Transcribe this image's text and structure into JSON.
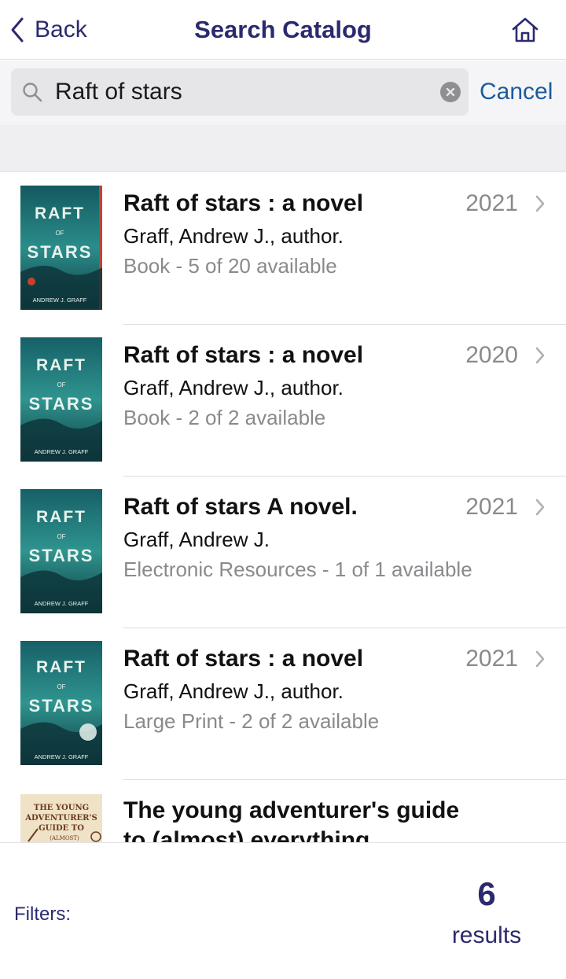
{
  "nav": {
    "back_label": "Back",
    "title": "Search Catalog",
    "home_icon": "home-icon"
  },
  "search": {
    "value": "Raft of stars",
    "placeholder": "",
    "cancel_label": "Cancel"
  },
  "results": [
    {
      "title": "Raft of stars : a novel",
      "author": "Graff, Andrew J., author.",
      "format": "Book - 5 of 20 available",
      "year": "2021",
      "cover": {
        "line1": "RAFT",
        "line2": "OF",
        "line3": "STARS",
        "byline": "ANDREW J. GRAFF"
      }
    },
    {
      "title": "Raft of stars : a novel",
      "author": "Graff, Andrew J., author.",
      "format": "Book - 2 of 2 available",
      "year": "2020",
      "cover": {
        "line1": "RAFT",
        "line2": "OF",
        "line3": "STARS",
        "byline": "ANDREW J. GRAFF"
      }
    },
    {
      "title": "Raft of stars A novel.",
      "author": "Graff, Andrew J.",
      "format": "Electronic Resources - 1 of 1 available",
      "year": "2021",
      "cover": {
        "line1": "RAFT",
        "line2": "OF",
        "line3": "STARS",
        "byline": "ANDREW J. GRAFF"
      }
    },
    {
      "title": "Raft of stars : a novel",
      "author": "Graff, Andrew J., author.",
      "format": "Large Print - 2 of 2 available",
      "year": "2021",
      "cover": {
        "line1": "RAFT",
        "line2": "OF",
        "line3": "STARS",
        "byline": "ANDREW J. GRAFF"
      }
    },
    {
      "title": "The young adventurer's guide to (almost) everything",
      "cover": {
        "line1": "THE YOUNG",
        "line2": "ADVENTURER'S",
        "line3": "GUIDE TO",
        "byline": "(ALMOST)"
      }
    }
  ],
  "footer": {
    "filters_label": "Filters:",
    "count": "6",
    "count_label": "results"
  },
  "colors": {
    "accent": "#2b2a6e",
    "link": "#1b5c9c",
    "muted": "#8a8a8e",
    "cover_teal": "#1f6f74",
    "cover_red": "#c8402f"
  }
}
